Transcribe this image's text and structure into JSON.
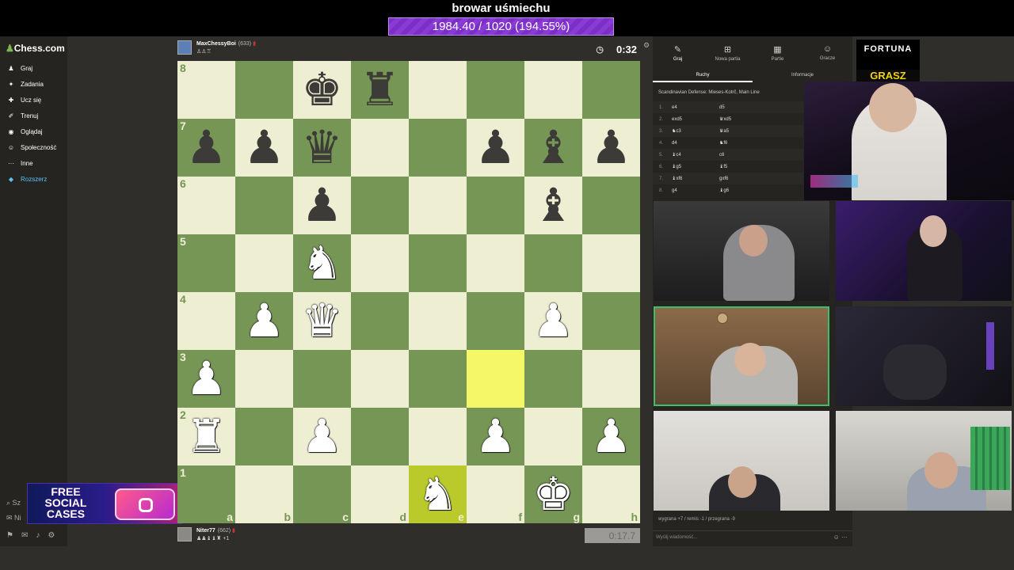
{
  "overlay": {
    "title": "browar uśmiechu",
    "goal": "1984.40 / 1020 (194.55%)"
  },
  "sidebar": {
    "logo": "Chess.com",
    "items": [
      {
        "label": "Graj",
        "icon": "♟"
      },
      {
        "label": "Zadania",
        "icon": "✦"
      },
      {
        "label": "Ucz się",
        "icon": "✚"
      },
      {
        "label": "Trenuj",
        "icon": "✐"
      },
      {
        "label": "Oglądaj",
        "icon": "◉"
      },
      {
        "label": "Społeczność",
        "icon": "☺"
      },
      {
        "label": "Inne",
        "icon": "···"
      },
      {
        "label": "Rozszerz",
        "icon": "◆"
      }
    ],
    "search_label": "Sz",
    "messages_label": "Ni"
  },
  "ad": {
    "text": "FREE SOCIAL CASES"
  },
  "top_player": {
    "name": "MaxChessyBoi",
    "rating": "(633)",
    "captured": "♙♙♖",
    "clock": "0:32"
  },
  "bottom_player": {
    "name": "Niter77",
    "rating": "(662)",
    "captured": "♟♟♝♝♜ +1",
    "clock": "0:17.7"
  },
  "board": {
    "ranks": [
      "8",
      "7",
      "6",
      "5",
      "4",
      "3",
      "2",
      "1"
    ],
    "files": [
      "a",
      "b",
      "c",
      "d",
      "e",
      "f",
      "g",
      "h"
    ],
    "squares": [
      [
        "",
        "",
        "♚b",
        "♜b",
        "",
        "",
        "",
        ""
      ],
      [
        "♟b",
        "♟b",
        "♛b",
        "",
        "",
        "♟b",
        "♝b",
        "♟b"
      ],
      [
        "",
        "",
        "♟b",
        "",
        "",
        "",
        "♝b",
        ""
      ],
      [
        "",
        "",
        "♞w",
        "",
        "",
        "",
        "",
        ""
      ],
      [
        "",
        "♟w",
        "♛w",
        "",
        "",
        "",
        "♟w",
        ""
      ],
      [
        "♟w",
        "",
        "",
        "",
        "",
        "",
        "",
        ""
      ],
      [
        "♜w",
        "",
        "♟w",
        "",
        "",
        "♟w",
        "",
        "♟w"
      ],
      [
        "",
        "",
        "",
        "",
        "♞w",
        "",
        "♚w",
        ""
      ]
    ],
    "highlights": [
      "f3",
      "e1"
    ]
  },
  "right_panel": {
    "tabs": [
      {
        "label": "Graj",
        "icon": "✎"
      },
      {
        "label": "Nowa partia",
        "icon": "⊞"
      },
      {
        "label": "Partie",
        "icon": "▦"
      },
      {
        "label": "Gracze",
        "icon": "☺"
      }
    ],
    "subtabs": [
      "Ruchy",
      "Informacje"
    ],
    "opening": "Scandinavian Defense: Mieses-Kotrč, Main Line",
    "moves": [
      {
        "n": "1.",
        "w": "e4",
        "b": "d5"
      },
      {
        "n": "2.",
        "w": "exd5",
        "b": "♛xd5"
      },
      {
        "n": "3.",
        "w": "♞c3",
        "b": "♛a5"
      },
      {
        "n": "4.",
        "w": "d4",
        "b": "♞f6"
      },
      {
        "n": "5.",
        "w": "♝c4",
        "b": "c6"
      },
      {
        "n": "6.",
        "w": "♝g5",
        "b": "♝f5"
      },
      {
        "n": "7.",
        "w": "♝xf6",
        "b": "gxf6"
      },
      {
        "n": "8.",
        "w": "g4",
        "b": "♝g6"
      }
    ],
    "results": "wygrana +7 / remis -1 / przegrana -9",
    "message_placeholder": "Wyślij wiadomość..."
  },
  "sponsor": {
    "line1": "FORTUNA",
    "line2": "GRASZ"
  },
  "colors": {
    "light_square": "#eeeed2",
    "dark_square": "#769656",
    "highlight": "#f6f669",
    "goal_bar": "#7b2fc4",
    "active_cam_border": "#3fbf6a"
  }
}
